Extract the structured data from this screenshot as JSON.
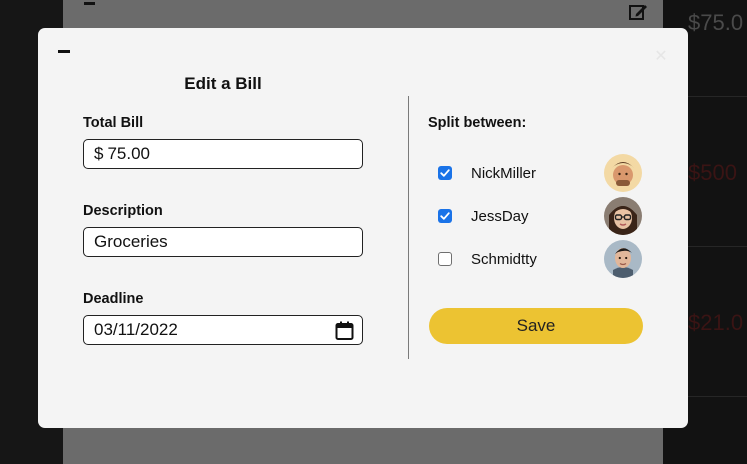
{
  "background": {
    "amounts": [
      {
        "text": "$75.0",
        "color": "#4a4a4a"
      },
      {
        "text": "$500",
        "color": "#3a1414"
      },
      {
        "text": "$21.0",
        "color": "#3a1414"
      }
    ]
  },
  "modal": {
    "title": "Edit a Bill",
    "total_bill": {
      "label": "Total Bill",
      "currency": "$",
      "value": "75.00"
    },
    "description": {
      "label": "Description",
      "value": "Groceries"
    },
    "deadline": {
      "label": "Deadline",
      "value": "03/11/2022"
    },
    "split": {
      "label": "Split between:",
      "members": [
        {
          "name": "NickMiller",
          "checked": true
        },
        {
          "name": "JessDay",
          "checked": true
        },
        {
          "name": "Schmidtty",
          "checked": false
        }
      ]
    },
    "save_label": "Save"
  },
  "colors": {
    "accent": "#ecc332",
    "checkbox": "#1a73e8",
    "modal_bg": "#f4f4f4"
  }
}
